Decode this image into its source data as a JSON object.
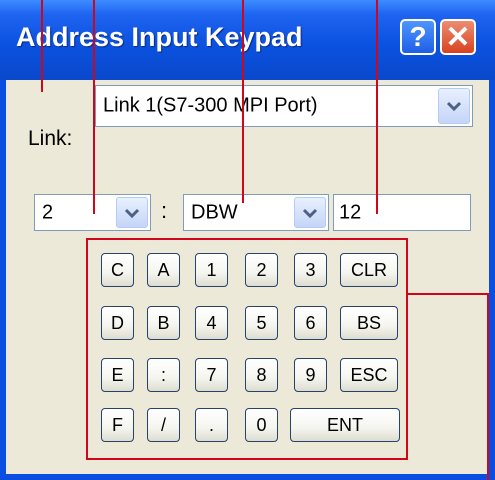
{
  "window": {
    "title": "Address Input Keypad",
    "help_glyph": "?",
    "close_glyph": "✕"
  },
  "link": {
    "label": "Link:",
    "value": "Link 1(S7-300 MPI Port)"
  },
  "address": {
    "number_value": "2",
    "separator": ":",
    "area_value": "DBW",
    "offset_value": "12"
  },
  "keypad": {
    "keys": [
      {
        "label": "C"
      },
      {
        "label": "A"
      },
      {
        "label": "1"
      },
      {
        "label": "2"
      },
      {
        "label": "3"
      },
      {
        "label": "CLR"
      },
      {
        "label": "D"
      },
      {
        "label": "B"
      },
      {
        "label": "4"
      },
      {
        "label": "5"
      },
      {
        "label": "6"
      },
      {
        "label": "BS"
      },
      {
        "label": "E"
      },
      {
        "label": ":"
      },
      {
        "label": "7"
      },
      {
        "label": "8"
      },
      {
        "label": "9"
      },
      {
        "label": "ESC"
      },
      {
        "label": "F"
      },
      {
        "label": "/"
      },
      {
        "label": "."
      },
      {
        "label": "0"
      },
      {
        "label": "ENT"
      }
    ]
  },
  "colors": {
    "titlebar": "#0b52e0",
    "annotation": "#d0071b",
    "window_bg": "#ece9d8"
  }
}
